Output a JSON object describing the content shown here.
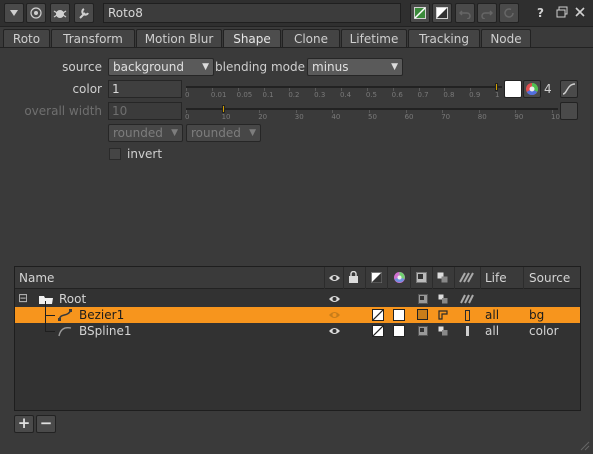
{
  "node_name": "Roto8",
  "help_label": "?",
  "tabs": [
    "Roto",
    "Transform",
    "Motion Blur",
    "Shape",
    "Clone",
    "Lifetime",
    "Tracking",
    "Node"
  ],
  "active_tab": "Shape",
  "form": {
    "source_label": "source",
    "source_value": "background",
    "blending_mode_label": "blending mode",
    "blending_mode_value": "minus",
    "color_label": "color",
    "color_value": "1",
    "color_slider_ticks": [
      "0",
      "0.01",
      "0.05",
      "0.1",
      "0.2",
      "0.3",
      "0.4",
      "0.5",
      "0.6",
      "0.7",
      "0.8",
      "0.9",
      "1"
    ],
    "color_slider_value": 1,
    "channels_count": "4",
    "overall_width_label": "overall width",
    "overall_width_value": "10",
    "width_slider_ticks": [
      "0",
      "10",
      "20",
      "30",
      "40",
      "50",
      "60",
      "70",
      "80",
      "90",
      "100"
    ],
    "width_slider_value": 10,
    "start_shape_value": "rounded",
    "end_shape_value": "rounded",
    "invert_label": "invert",
    "invert_checked": false
  },
  "tree": {
    "columns": {
      "name": "Name",
      "life": "Life",
      "source": "Source"
    },
    "rows": [
      {
        "name": "Root",
        "life": "",
        "source": "",
        "selected": false,
        "type": "root"
      },
      {
        "name": "Bezier1",
        "life": "all",
        "source": "bg",
        "selected": true,
        "type": "bezier"
      },
      {
        "name": "BSpline1",
        "life": "all",
        "source": "color",
        "selected": false,
        "type": "bspline"
      }
    ]
  },
  "bottom": {
    "add_label": "+",
    "remove_label": "−"
  },
  "colors": {
    "selection": "#f7951d",
    "panel": "#3a3a3a",
    "slider_handle": "#d0a000"
  }
}
